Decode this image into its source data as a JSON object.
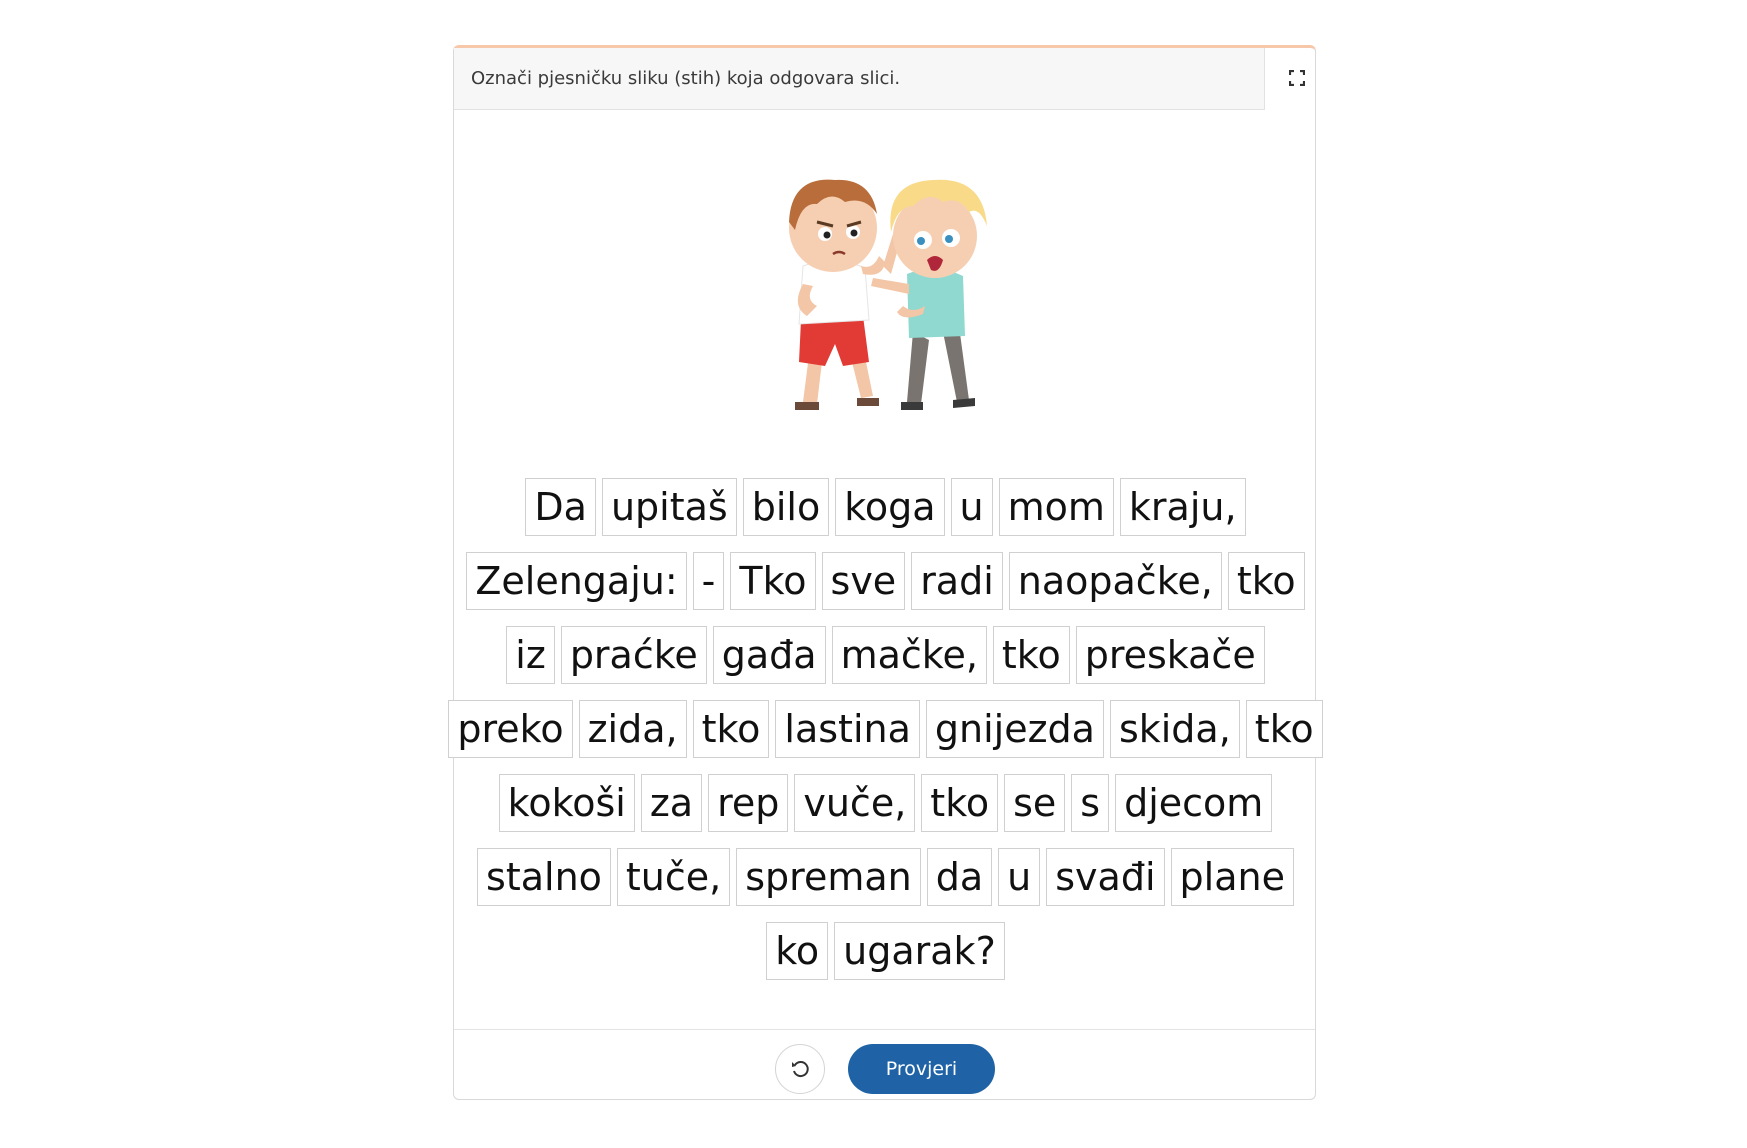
{
  "header": {
    "instruction": "Označi pjesničku sliku (stih) koja odgovara slici.",
    "fullscreen_icon": "expand-icon"
  },
  "illustration": {
    "description_icon": "two-boys-fighting-illustration"
  },
  "words": {
    "rows": [
      [
        "Da",
        "upitaš",
        "bilo",
        "koga",
        "u",
        "mom",
        "kraju,"
      ],
      [
        "Zelengaju:",
        "-",
        "Tko",
        "sve",
        "radi",
        "naopačke,",
        "tko"
      ],
      [
        "iz",
        "praćke",
        "gađa",
        "mačke,",
        "tko",
        "preskače"
      ],
      [
        "preko",
        "zida,",
        "tko",
        "lastina",
        "gnijezda",
        "skida,",
        "tko"
      ],
      [
        "kokoši",
        "za",
        "rep",
        "vuče,",
        "tko",
        "se",
        "s",
        "djecom"
      ],
      [
        "stalno",
        "tuče,",
        "spreman",
        "da",
        "u",
        "svađi",
        "plane"
      ],
      [
        "ko",
        "ugarak?"
      ]
    ]
  },
  "footer": {
    "reset_icon": "reset-icon",
    "check_label": "Provjeri"
  },
  "colors": {
    "accent_top_border": "#f6c7a8",
    "primary_button": "#1f63a6"
  }
}
